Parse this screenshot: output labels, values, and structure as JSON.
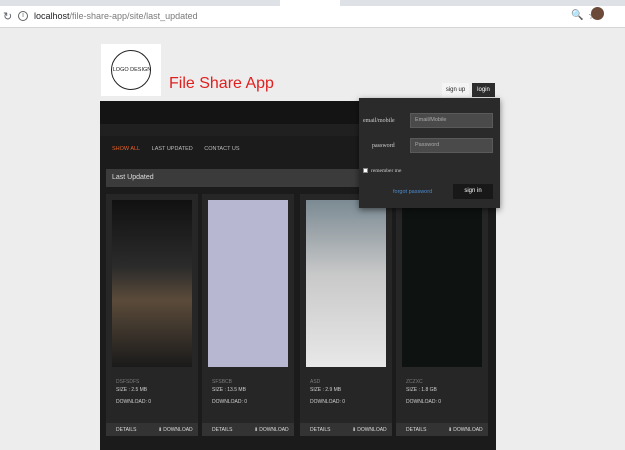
{
  "browser": {
    "url_host": "localhost",
    "url_path": "/file-share-app/site/last_updated"
  },
  "site": {
    "logo_text": "LOGO DESIGN",
    "title": "File Share App",
    "signup_label": "sign up",
    "login_label": "login"
  },
  "nav": {
    "items": [
      "SHOW ALL",
      "LAST UPDATED",
      "CONTACT US"
    ]
  },
  "section": {
    "title": "Last Updated"
  },
  "files": [
    {
      "name": "DSFSDFS",
      "size": "SIZE : 2.5 MB",
      "downloads": "DOWNLOAD: 0"
    },
    {
      "name": "SFSBCB",
      "size": "SIZE : 13.5 MB",
      "downloads": "DOWNLOAD: 0"
    },
    {
      "name": "ASD",
      "size": "SIZE : 2.9 MB",
      "downloads": "DOWNLOAD: 0"
    },
    {
      "name": "ZCZXC",
      "size": "SIZE : 1.8 GB",
      "downloads": "DOWNLOAD: 0"
    }
  ],
  "card_actions": {
    "details_label": "DETAILS",
    "download_label": "DOWNLOAD"
  },
  "login_panel": {
    "email_label": "email/mobile",
    "email_placeholder": "Email/Mobile",
    "password_label": "password",
    "password_placeholder": "Password",
    "remember_label": "remember me",
    "forgot_label": "forgot password",
    "signin_label": "sign in"
  },
  "colors": {
    "title_red": "#e0201f",
    "nav_active": "#e3612c",
    "link_blue": "#4a8bd0"
  }
}
